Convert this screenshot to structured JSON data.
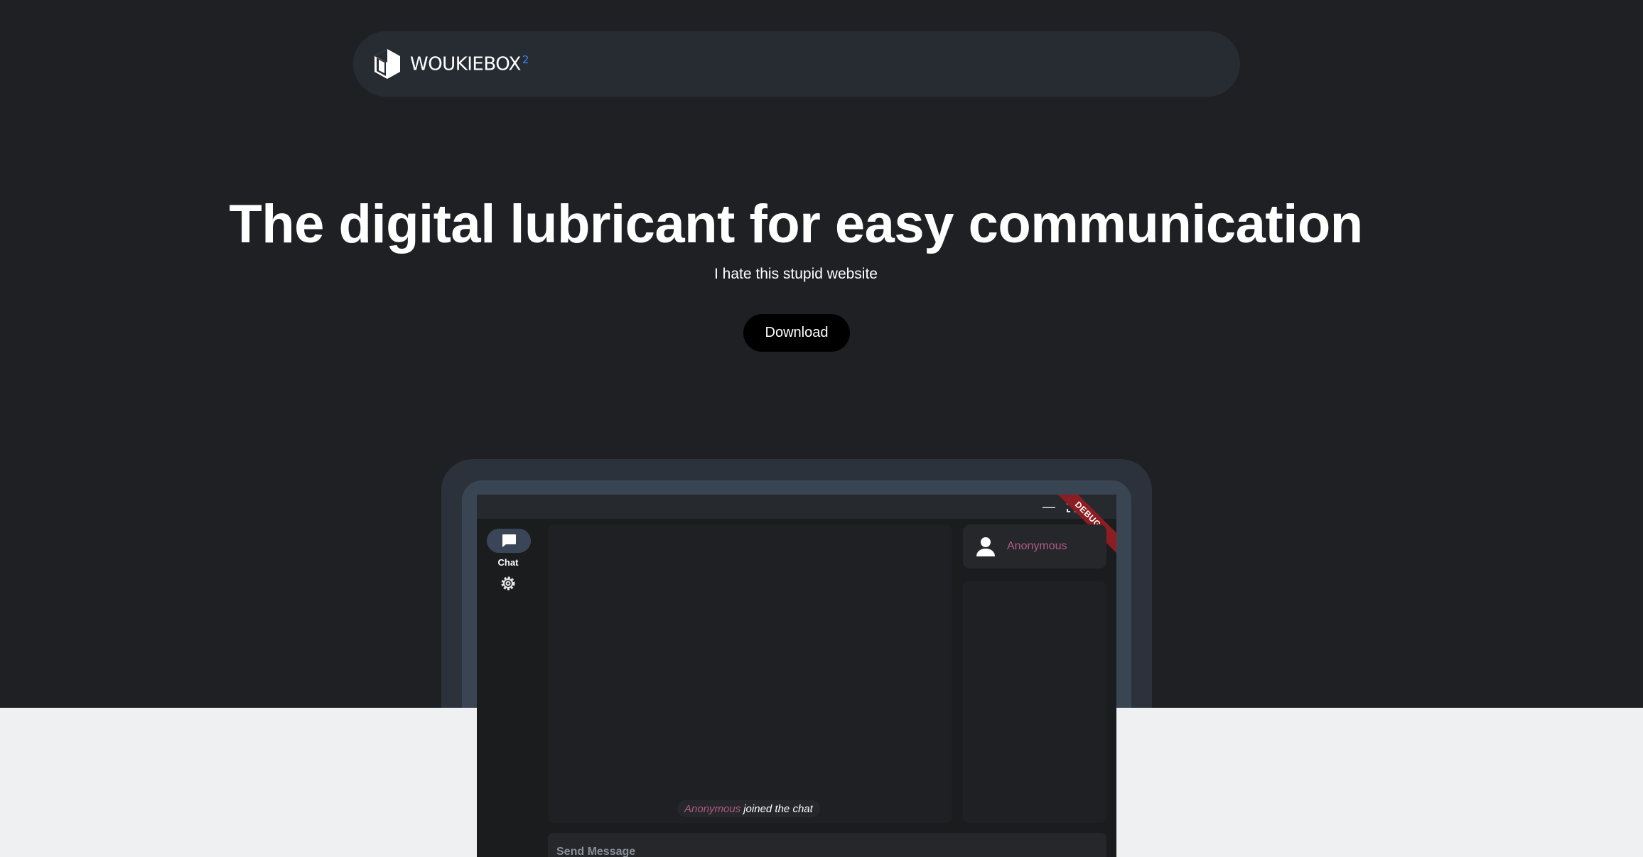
{
  "brand": {
    "name": "WOUKIEBOX",
    "superscript": "2"
  },
  "hero": {
    "title": "The digital lubricant for easy communication",
    "subtitle": "I hate this stupid website",
    "cta_label": "Download"
  },
  "app_preview": {
    "window_controls": {
      "minimize": "—",
      "maximize": "⛶"
    },
    "debug_banner": "DEBUG",
    "rail": {
      "chat_label": "Chat"
    },
    "chat": {
      "join_user": "Anonymous",
      "join_text": "joined the chat"
    },
    "user": {
      "name": "Anonymous"
    },
    "send_placeholder": "Send Message"
  },
  "colors": {
    "page_bg": "#1e2024",
    "nav_bg": "#272c33",
    "accent_blue": "#3b82f6",
    "username_pink": "#b15a86",
    "bottom_band": "#eef0f2"
  }
}
